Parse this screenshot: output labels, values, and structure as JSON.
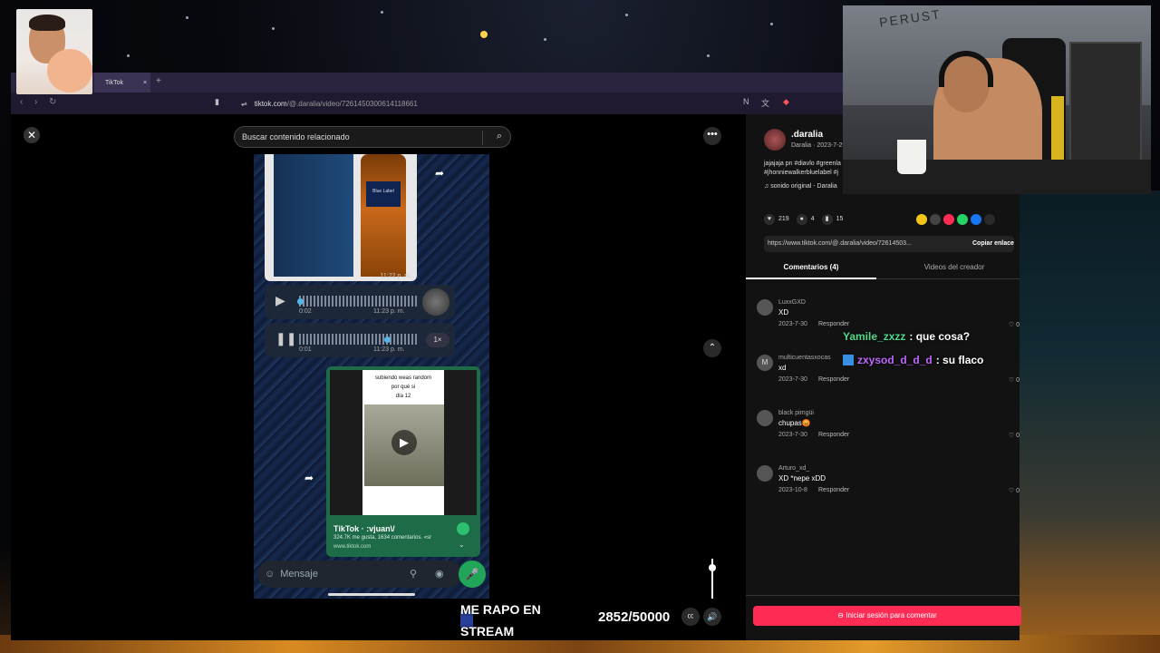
{
  "browser": {
    "tab_title": "TikTok",
    "tab_close": "×",
    "new_tab": "+",
    "url_domain": "tiktok.com",
    "url_path": "/@.daralia/video/7261450300614118661"
  },
  "tiktok": {
    "search_placeholder": "Buscar contenido relacionado",
    "close_symbol": "✕",
    "more_symbol": "•••",
    "up_symbol": "⌃",
    "volume_symbol": "🔊",
    "cc_symbol": "㏄"
  },
  "video": {
    "image_time": "11:22 p. m.",
    "bottle_label": "Blue Label",
    "audio1": {
      "duration": "0:02",
      "time": "11:23 p. m."
    },
    "audio2": {
      "duration": "0:01",
      "time": "11:23 p. m.",
      "speed": "1×"
    },
    "shared": {
      "overlay_line1": "subiendo weas random",
      "overlay_line2": "por qué si",
      "overlay_line3": "día 12",
      "title": "TikTok · :vjuan\\/",
      "subtitle": "324.7K me gusta, 1634 comentarios. «sr",
      "url": "www.tiktok.com"
    },
    "message_placeholder": "Mensaje"
  },
  "panel": {
    "author_name": ".daralia",
    "author_sub": "Daralia · 2023-7-29",
    "caption": "jajajaja pn #diavlo #greenla #jhonniewalkerbluelabel #j",
    "music": "♫ sonido original - Daralia",
    "likes": "219",
    "comments": "4",
    "saves": "15",
    "link": "https://www.tiktok.com/@.daralia/video/72614503...",
    "copy_link": "Copiar enlace",
    "tab_comments": "Comentarios (4)",
    "tab_videos": "Videos del creador",
    "login_button": "Iniciar sesión para comentar",
    "share_colors": [
      "#f5c518",
      "#444444",
      "#fe2c55",
      "#25d366",
      "#1877f2",
      "#2a2a2a"
    ]
  },
  "comments": [
    {
      "user": "LuxxGXD",
      "text": "XD",
      "date": "2023-7-30",
      "reply": "Responder",
      "likes": "0",
      "avatar": ""
    },
    {
      "user": "multicuentasxocas",
      "text": "xd",
      "date": "2023-7-30",
      "reply": "Responder",
      "likes": "0",
      "avatar": "M"
    },
    {
      "user": "black pimgüi",
      "text": "chupas😡",
      "date": "2023-7-30",
      "reply": "Responder",
      "likes": "0",
      "avatar": ""
    },
    {
      "user": "Arturo_xd_",
      "text": "XD *nepe xDD",
      "date": "2023-10-8",
      "reply": "Responder",
      "likes": "0",
      "avatar": ""
    }
  ],
  "chat": [
    {
      "user": "Yamile_zxzz",
      "message": ": que cosa?"
    },
    {
      "user": "zxysod_d_d_d",
      "message": ": su flaco"
    }
  ],
  "stream_goal": {
    "text": "ME RAPO EN STREAM",
    "counter": "2852/50000"
  },
  "webcam_poster": "PERUST"
}
